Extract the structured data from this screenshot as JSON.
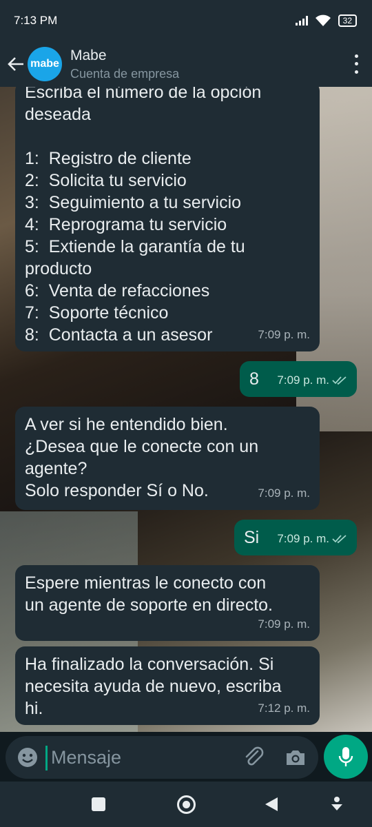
{
  "status_bar": {
    "time": "7:13 PM",
    "battery": "32",
    "icons": [
      "signal-icon",
      "wifi-icon",
      "battery-icon"
    ]
  },
  "header": {
    "avatar_text": "mabe",
    "contact_name": "Mabe",
    "contact_subtitle": "Cuenta de empresa"
  },
  "messages": [
    {
      "direction": "in",
      "text": "Escriba el número de la opción\ndeseada\n\n1:  Registro de cliente\n2:  Solicita tu servicio\n3:  Seguimiento a tu servicio\n4:  Reprograma tu servicio\n5:  Extiende la garantía de tu\nproducto\n6:  Venta de refacciones\n7:  Soporte técnico\n8:  Contacta a un asesor",
      "time": "7:09 p. m."
    },
    {
      "direction": "out",
      "text": "8",
      "time": "7:09 p. m.",
      "status": "read"
    },
    {
      "direction": "in",
      "text": "A ver si he entendido bien.\n¿Desea que le conecte con un\nagente?\nSolo responder Sí o No.",
      "time": "7:09 p. m."
    },
    {
      "direction": "out",
      "text": "Si",
      "time": "7:09 p. m.",
      "status": "read"
    },
    {
      "direction": "in",
      "text": "Espere mientras le conecto con\nun agente de soporte en directo.",
      "time": "7:09 p. m."
    },
    {
      "direction": "in",
      "text": "Ha finalizado la conversación. Si\nnecesita ayuda de nuevo, escriba\nhi.",
      "time": "7:12 p. m."
    }
  ],
  "composer": {
    "placeholder": "Mensaje"
  },
  "colors": {
    "incoming_bubble": "#1f2c34",
    "outgoing_bubble": "#005c4b",
    "accent": "#00a884",
    "avatar": "#1aa5e8"
  }
}
